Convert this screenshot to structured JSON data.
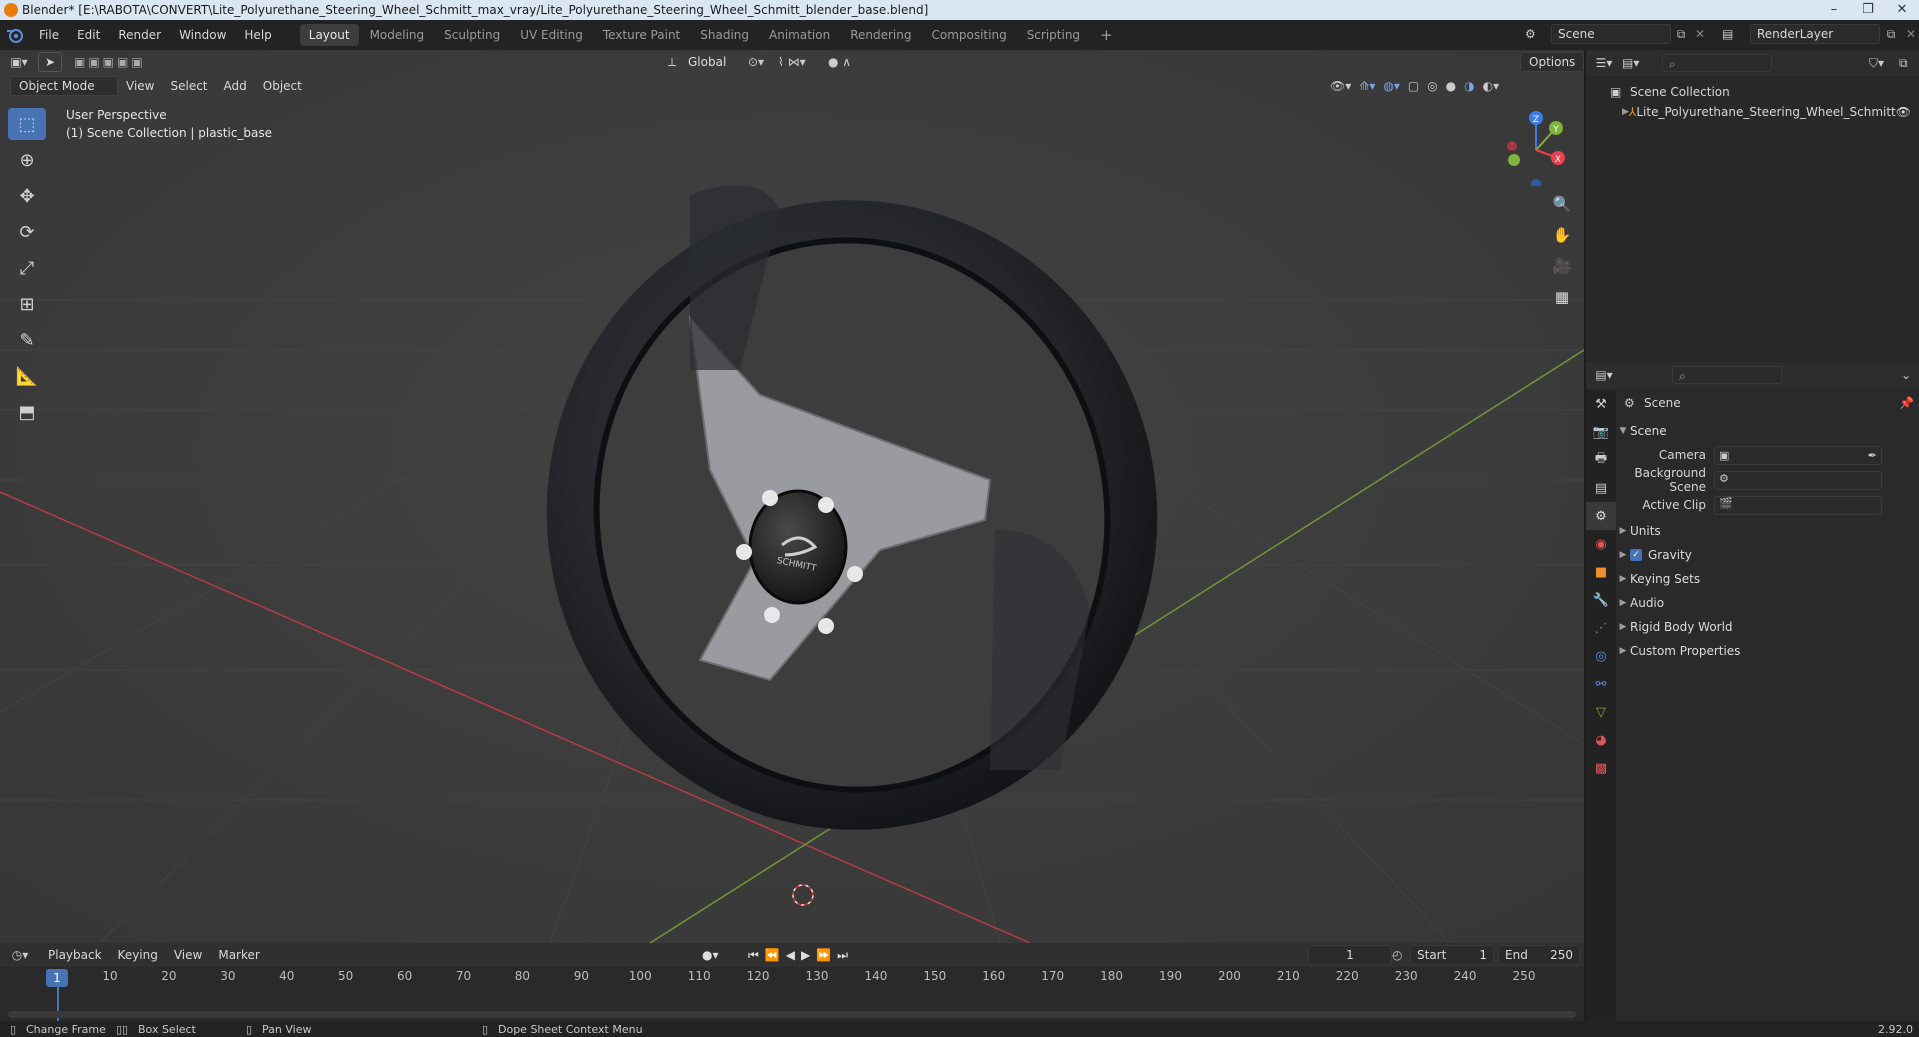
{
  "window": {
    "title": "Blender* [E:\\RABOTA\\CONVERT\\Lite_Polyurethane_Steering_Wheel_Schmitt_max_vray/Lite_Polyurethane_Steering_Wheel_Schmitt_blender_base.blend]",
    "controls": [
      "–",
      "❐",
      "✕"
    ]
  },
  "menu": [
    "File",
    "Edit",
    "Render",
    "Window",
    "Help"
  ],
  "workspaces": [
    {
      "label": "Layout",
      "active": true
    },
    {
      "label": "Modeling",
      "active": false
    },
    {
      "label": "Sculpting",
      "active": false
    },
    {
      "label": "UV Editing",
      "active": false
    },
    {
      "label": "Texture Paint",
      "active": false
    },
    {
      "label": "Shading",
      "active": false
    },
    {
      "label": "Animation",
      "active": false
    },
    {
      "label": "Rendering",
      "active": false
    },
    {
      "label": "Compositing",
      "active": false
    },
    {
      "label": "Scripting",
      "active": false
    }
  ],
  "add_workspace": "+",
  "scene_selector": "Scene",
  "view_layer_selector": "RenderLayer",
  "viewport": {
    "transform_orientation": "Global",
    "options_label": "Options",
    "mode": "Object Mode",
    "header_menus": [
      "View",
      "Select",
      "Add",
      "Object"
    ],
    "overlay_line1": "User Perspective",
    "overlay_line2": "(1) Scene Collection | plastic_base",
    "gizmo_axes": {
      "z": "Z",
      "y": "Y",
      "x": "X"
    },
    "logo_text": "SCHMITT"
  },
  "outliner": {
    "root": "Scene Collection",
    "items": [
      {
        "label": "Lite_Polyurethane_Steering_Wheel_Schmitt"
      }
    ]
  },
  "properties": {
    "context": "Scene",
    "panel": "Scene",
    "fields": [
      {
        "label": "Camera"
      },
      {
        "label": "Background Scene"
      },
      {
        "label": "Active Clip"
      }
    ],
    "sections": [
      {
        "label": "Units",
        "checkbox": false
      },
      {
        "label": "Gravity",
        "checkbox": true
      },
      {
        "label": "Keying Sets",
        "checkbox": false
      },
      {
        "label": "Audio",
        "checkbox": false
      },
      {
        "label": "Rigid Body World",
        "checkbox": false
      },
      {
        "label": "Custom Properties",
        "checkbox": false
      }
    ]
  },
  "timeline": {
    "menus": [
      "Playback",
      "Keying",
      "View",
      "Marker"
    ],
    "current_frame": "1",
    "start_label": "Start",
    "start": "1",
    "end_label": "End",
    "end": "250",
    "ticks": [
      "10",
      "20",
      "30",
      "40",
      "50",
      "60",
      "70",
      "80",
      "90",
      "100",
      "110",
      "120",
      "130",
      "140",
      "150",
      "160",
      "170",
      "180",
      "190",
      "200",
      "210",
      "220",
      "230",
      "240",
      "250"
    ],
    "playhead": "1"
  },
  "statusbar": {
    "items": [
      "Change Frame",
      "Box Select",
      "Pan View",
      "Dope Sheet Context Menu"
    ],
    "version": "2.92.0"
  },
  "colors": {
    "accent": "#4772b3",
    "x_axis": "#e8414e",
    "y_axis": "#7fb33b",
    "z_axis": "#3d7ce6"
  }
}
